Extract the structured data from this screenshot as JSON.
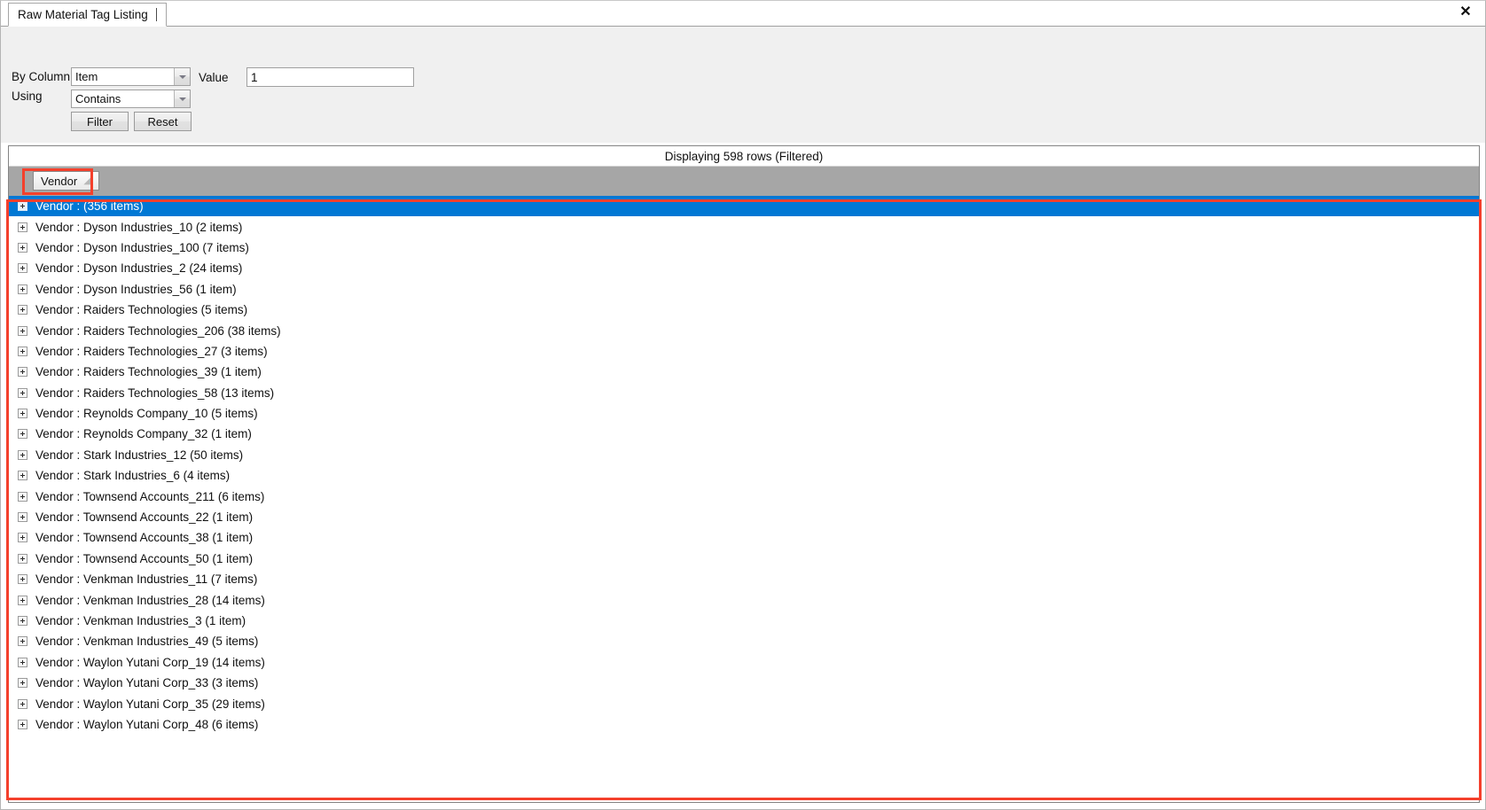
{
  "window": {
    "close_icon": "✕"
  },
  "tab": {
    "label": "Raw Material Tag Listing"
  },
  "filter": {
    "by_column_label": "By Column",
    "using_label": "Using",
    "value_label": "Value",
    "column_selected": "Item",
    "using_selected": "Contains",
    "value_text": "1",
    "value_placeholder": "",
    "filter_button": "Filter",
    "reset_button": "Reset"
  },
  "grid": {
    "status_text": "Displaying 598 rows (Filtered)",
    "group_chip": {
      "label": "Vendor",
      "sort_arrow": "◢"
    },
    "rows": [
      {
        "text": "Vendor :  (356 items)",
        "selected": true
      },
      {
        "text": "Vendor : Dyson Industries_10 (2 items)",
        "selected": false
      },
      {
        "text": "Vendor : Dyson Industries_100 (7 items)",
        "selected": false
      },
      {
        "text": "Vendor : Dyson Industries_2 (24 items)",
        "selected": false
      },
      {
        "text": "Vendor : Dyson Industries_56 (1 item)",
        "selected": false
      },
      {
        "text": "Vendor : Raiders Technologies (5 items)",
        "selected": false
      },
      {
        "text": "Vendor : Raiders Technologies_206 (38 items)",
        "selected": false
      },
      {
        "text": "Vendor : Raiders Technologies_27 (3 items)",
        "selected": false
      },
      {
        "text": "Vendor : Raiders Technologies_39 (1 item)",
        "selected": false
      },
      {
        "text": "Vendor : Raiders Technologies_58 (13 items)",
        "selected": false
      },
      {
        "text": "Vendor : Reynolds Company_10 (5 items)",
        "selected": false
      },
      {
        "text": "Vendor : Reynolds Company_32 (1 item)",
        "selected": false
      },
      {
        "text": "Vendor : Stark Industries_12 (50 items)",
        "selected": false
      },
      {
        "text": "Vendor : Stark Industries_6 (4 items)",
        "selected": false
      },
      {
        "text": "Vendor : Townsend Accounts_211 (6 items)",
        "selected": false
      },
      {
        "text": "Vendor : Townsend Accounts_22 (1 item)",
        "selected": false
      },
      {
        "text": "Vendor : Townsend Accounts_38 (1 item)",
        "selected": false
      },
      {
        "text": "Vendor : Townsend Accounts_50 (1 item)",
        "selected": false
      },
      {
        "text": "Vendor : Venkman Industries_11 (7 items)",
        "selected": false
      },
      {
        "text": "Vendor : Venkman Industries_28 (14 items)",
        "selected": false
      },
      {
        "text": "Vendor : Venkman Industries_3 (1 item)",
        "selected": false
      },
      {
        "text": "Vendor : Venkman Industries_49 (5 items)",
        "selected": false
      },
      {
        "text": "Vendor : Waylon Yutani Corp_19 (14 items)",
        "selected": false
      },
      {
        "text": "Vendor : Waylon Yutani Corp_33 (3 items)",
        "selected": false
      },
      {
        "text": "Vendor : Waylon Yutani Corp_35 (29 items)",
        "selected": false
      },
      {
        "text": "Vendor : Waylon Yutani Corp_48 (6 items)",
        "selected": false
      }
    ]
  },
  "colors": {
    "selection_blue": "#0078d4",
    "group_panel_gray": "#a6a6a6",
    "annotation_red": "#f4402c",
    "panel_gray": "#f0f0f0"
  }
}
